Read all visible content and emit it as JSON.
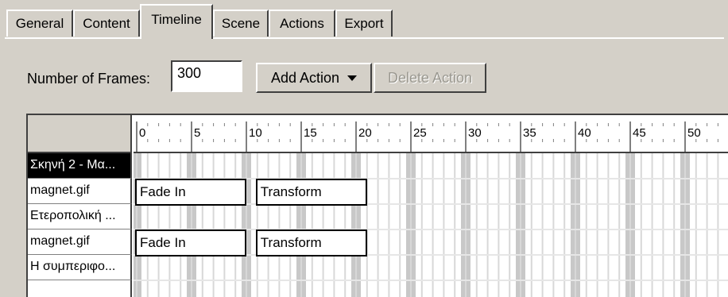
{
  "tabs": [
    {
      "label": "General"
    },
    {
      "label": "Content"
    },
    {
      "label": "Timeline",
      "active": true
    },
    {
      "label": "Scene"
    },
    {
      "label": "Actions"
    },
    {
      "label": "Export"
    }
  ],
  "frames": {
    "label": "Number of Frames:",
    "value": "300"
  },
  "buttons": {
    "add_action": "Add Action",
    "delete_action": "Delete Action"
  },
  "timeline": {
    "ruler_labels": [
      "0",
      "5",
      "10",
      "15",
      "20",
      "25",
      "30",
      "35",
      "40",
      "45",
      "50"
    ],
    "rows": [
      {
        "label": "Σκηνή 2 - Μα...",
        "selected": true,
        "actions": []
      },
      {
        "label": "magnet.gif",
        "actions": [
          {
            "label": "Fade In",
            "start": 0,
            "end": 10
          },
          {
            "label": "Transform",
            "start": 11,
            "end": 21
          }
        ]
      },
      {
        "label": "Ετεροπολική ...",
        "actions": []
      },
      {
        "label": "magnet.gif",
        "actions": [
          {
            "label": "Fade In",
            "start": 0,
            "end": 10
          },
          {
            "label": "Transform",
            "start": 11,
            "end": 21
          }
        ]
      },
      {
        "label": "Η συμπεριφο...",
        "actions": []
      }
    ]
  }
}
